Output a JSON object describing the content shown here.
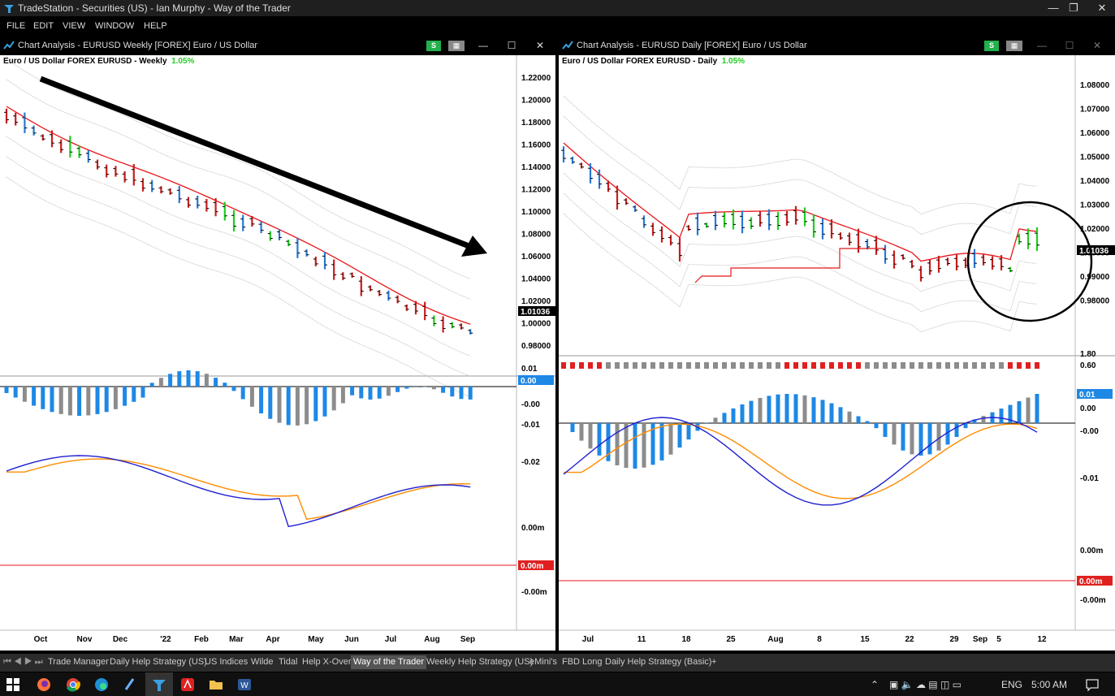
{
  "app": {
    "title": "TradeStation  - Securities (US) - Ian Murphy - Way of the Trader",
    "menu": [
      "FILE",
      "EDIT",
      "VIEW",
      "WINDOW",
      "HELP"
    ]
  },
  "left_panel": {
    "title": "Chart Analysis - EURUSD Weekly [FOREX] Euro / US Dollar",
    "header": "Euro / US Dollar  FOREX  EURUSD - Weekly",
    "change": "1.05%",
    "btn_s": "S",
    "last_price": "1.01036",
    "price_ticks": [
      "1.22000",
      "1.20000",
      "1.18000",
      "1.16000",
      "1.14000",
      "1.12000",
      "1.10000",
      "1.08000",
      "1.06000",
      "1.04000",
      "1.02000",
      "1.00000",
      "0.98000"
    ],
    "hist_ticks": [
      "0.01",
      "-0.00",
      "-0.01",
      "-0.02"
    ],
    "hist_flag": "0.00",
    "bottom_ticks": [
      "0.00m",
      "-0.00m"
    ],
    "bottom_flag": "0.00m",
    "x_labels": [
      "Oct",
      "Nov",
      "Dec",
      "'22",
      "Feb",
      "Mar",
      "Apr",
      "May",
      "Jun",
      "Jul",
      "Aug",
      "Sep"
    ]
  },
  "right_panel": {
    "title": "Chart Analysis - EURUSD Daily [FOREX] Euro / US Dollar",
    "header": "Euro / US Dollar  FOREX  EURUSD - Daily",
    "change": "1.05%",
    "btn_s": "S",
    "last_price": "1.01036",
    "price_ticks": [
      "1.08000",
      "1.07000",
      "1.06000",
      "1.05000",
      "1.04000",
      "1.03000",
      "1.02000",
      "1.00000",
      "0.99000",
      "0.98000"
    ],
    "mid_ticks": [
      "1.80",
      "0.60"
    ],
    "hist_ticks": [
      "0.00",
      "-0.00",
      "-0.01"
    ],
    "hist_flag": "0.01",
    "bottom_ticks": [
      "0.00m",
      "-0.00m"
    ],
    "bottom_flag": "0.00m",
    "x_labels": [
      "Jul",
      "11",
      "18",
      "25",
      "Aug",
      "8",
      "15",
      "22",
      "29",
      "Sep",
      "5",
      "12"
    ]
  },
  "tabs": [
    "Trade Manager",
    "Daily Help Strategy (US)",
    "US Indices",
    "Wilde",
    "Tidal",
    "Help X-Over",
    "Way of the Trader",
    "Weekly Help Strategy (US)",
    "eMini's",
    "FBD Long",
    "Daily Help Strategy (Basic)",
    "+"
  ],
  "active_tab": "Way of the Trader",
  "taskbar": {
    "lang": "ENG",
    "time": "5:00 AM"
  },
  "colors": {
    "bull": "#1ecc1e",
    "bear": "#c81e1e",
    "neutral": "#2a78d2",
    "hist_blue": "#1e88e5",
    "hist_gray": "#8c8c8c",
    "ma_red": "#e8161b",
    "macd_blue": "#2020d0",
    "signal_orange": "#ff8c00"
  }
}
